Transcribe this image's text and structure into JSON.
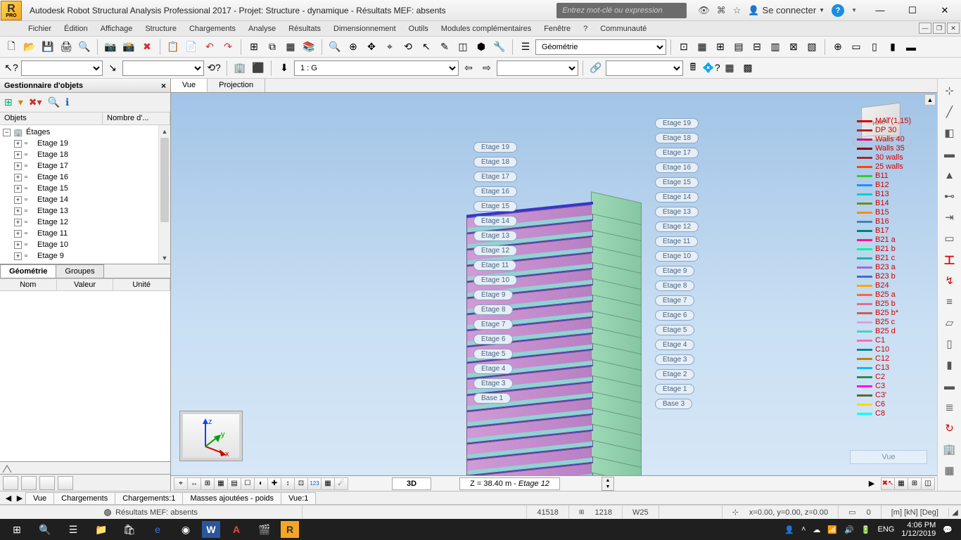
{
  "title": "Autodesk Robot Structural Analysis Professional 2017 - Projet: Structure - dynamique - Résultats MEF: absents",
  "logo_sub": "PRO",
  "search_placeholder": "Entrez mot-clé ou expression",
  "signin": "Se connecter",
  "menu": [
    "Fichier",
    "Édition",
    "Affichage",
    "Structure",
    "Chargements",
    "Analyse",
    "Résultats",
    "Dimensionnement",
    "Outils",
    "Modules complémentaires",
    "Fenêtre",
    "?",
    "Communauté"
  ],
  "layout_combo": "Géométrie",
  "load_combo": "1 : G",
  "obj_panel": {
    "title": "Gestionnaire d'objets",
    "cols": [
      "Objets",
      "Nombre d'..."
    ],
    "root": "Étages",
    "items": [
      "Etage 19",
      "Etage 18",
      "Etage 17",
      "Etage 16",
      "Etage 15",
      "Etage 14",
      "Etage 13",
      "Etage 12",
      "Etage 11",
      "Etage 10",
      "Etage 9"
    ],
    "tabs": [
      "Géométrie",
      "Groupes"
    ],
    "prop_cols": [
      "Nom",
      "Valeur",
      "Unité"
    ]
  },
  "viewport": {
    "tabs": [
      "Vue",
      "Projection"
    ],
    "cube_face": "HAUT",
    "mode": "3D",
    "z_info_prefix": "Z = 38.40 m - ",
    "z_info_em": "Etage 12",
    "ghost": "Vue"
  },
  "stories_right": [
    "Etage 19",
    "Etage 18",
    "Etage 17",
    "Etage 16",
    "Etage 15",
    "Etage 14",
    "Etage 13",
    "Etage 12",
    "Etage 11",
    "Etage 10",
    "Etage 9",
    "Etage 8",
    "Etage 7",
    "Etage 6",
    "Etage 5",
    "Etage 4",
    "Etage 3",
    "Etage 2",
    "Etage 1",
    "Base 3"
  ],
  "stories_left": [
    "Etage 19",
    "Etage 18",
    "Etage 17",
    "Etage 16",
    "Etage 15",
    "Etage 14",
    "Etage 13",
    "Etage 12",
    "Etage 11",
    "Etage 10",
    "Etage 9",
    "Etage 8",
    "Etage 7",
    "Etage 6",
    "Etage 5",
    "Etage 4",
    "Etage 3",
    "Base 1"
  ],
  "legend": [
    {
      "c": "#d40000",
      "t": "MAT(1,15)"
    },
    {
      "c": "#b22222",
      "t": "DP 30"
    },
    {
      "c": "#c71585",
      "t": "Walls 40"
    },
    {
      "c": "#8b0000",
      "t": "Walls 35"
    },
    {
      "c": "#a52a2a",
      "t": "30 walls"
    },
    {
      "c": "#ff4500",
      "t": "25 walls"
    },
    {
      "c": "#32cd32",
      "t": "B11"
    },
    {
      "c": "#1e90ff",
      "t": "B12"
    },
    {
      "c": "#00ced1",
      "t": "B13"
    },
    {
      "c": "#6b8e23",
      "t": "B14"
    },
    {
      "c": "#ff8c00",
      "t": "B15"
    },
    {
      "c": "#4682b4",
      "t": "B16"
    },
    {
      "c": "#008080",
      "t": "B17"
    },
    {
      "c": "#ff1493",
      "t": "B21 a"
    },
    {
      "c": "#00fa9a",
      "t": "B21 b"
    },
    {
      "c": "#20b2aa",
      "t": "B21 c"
    },
    {
      "c": "#9370db",
      "t": "B23 a"
    },
    {
      "c": "#4169e1",
      "t": "B23 b"
    },
    {
      "c": "#ffa500",
      "t": "B24"
    },
    {
      "c": "#ff6347",
      "t": "B25 a"
    },
    {
      "c": "#db7093",
      "t": "B25 b"
    },
    {
      "c": "#cd5c5c",
      "t": "B25 b*"
    },
    {
      "c": "#dda0dd",
      "t": "B25 c"
    },
    {
      "c": "#48d1cc",
      "t": "B25 d"
    },
    {
      "c": "#ff69b4",
      "t": "C1"
    },
    {
      "c": "#008b8b",
      "t": "C10"
    },
    {
      "c": "#b8860b",
      "t": "C12"
    },
    {
      "c": "#00bfff",
      "t": "C13"
    },
    {
      "c": "#2e8b57",
      "t": "C2"
    },
    {
      "c": "#ff00ff",
      "t": "C3"
    },
    {
      "c": "#556b2f",
      "t": "C3'"
    },
    {
      "c": "#ffd700",
      "t": "C6"
    },
    {
      "c": "#00ffff",
      "t": "C8"
    }
  ],
  "bottom_tabs": [
    "Vue",
    "Chargements",
    "Chargements:1",
    "Masses ajoutées - poids",
    "Vue:1"
  ],
  "status": {
    "results": "Résultats MEF: absents",
    "n1": "41518",
    "n2": "1218",
    "w": "W25",
    "coords": "x=0.00, y=0.00, z=0.00",
    "zero": "0",
    "units": "[m] [kN] [Deg]"
  },
  "taskbar": {
    "lang": "ENG",
    "time": "4:06 PM",
    "date": "1/12/2019"
  }
}
